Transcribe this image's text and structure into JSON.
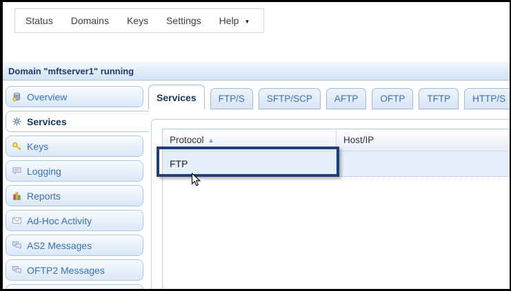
{
  "menu_bar": {
    "items": [
      "Status",
      "Domains",
      "Keys",
      "Settings",
      "Help"
    ]
  },
  "icons": {
    "caret_down": "▼",
    "sort_ascending": "▲"
  },
  "domain_header": {
    "title": "Domain \"mftserver1\" running"
  },
  "sidebar": {
    "items": [
      {
        "label": "Overview",
        "icon": "database-icon",
        "active": false
      },
      {
        "label": "Services",
        "icon": "services-icon",
        "active": true
      },
      {
        "label": "Keys",
        "icon": "key-icon",
        "active": false
      },
      {
        "label": "Logging",
        "icon": "speech-bubble-icon",
        "active": false
      },
      {
        "label": "Reports",
        "icon": "bar-chart-icon",
        "active": false
      },
      {
        "label": "Ad-Hoc Activity",
        "icon": "envelope-icon",
        "active": false
      },
      {
        "label": "AS2 Messages",
        "icon": "chat-bubbles-icon",
        "active": false
      },
      {
        "label": "OFTP2 Messages",
        "icon": "chat-bubbles-icon",
        "active": false
      }
    ]
  },
  "tabs": {
    "items": [
      {
        "label": "Services",
        "active": true
      },
      {
        "label": "FTP/S",
        "active": false
      },
      {
        "label": "SFTP/SCP",
        "active": false
      },
      {
        "label": "AFTP",
        "active": false
      },
      {
        "label": "OFTP",
        "active": false
      },
      {
        "label": "TFTP",
        "active": false
      },
      {
        "label": "HTTP/S",
        "active": false
      }
    ]
  },
  "services_table": {
    "columns": [
      {
        "label": "Protocol",
        "sorted": "ascending"
      },
      {
        "label": "Host/IP",
        "sorted": null
      }
    ],
    "rows": [
      {
        "protocol": "FTP",
        "host_ip": "",
        "selected": true,
        "highlighted": true
      }
    ]
  },
  "colors": {
    "domain_header_text": "#1c3a6e",
    "sidebar_link_text": "#3a6fb0",
    "active_tab_text": "#16365c",
    "selected_row_bg": "#e5effa",
    "highlight_box_border": "#1e3f78",
    "tab_border": "#9db9dc"
  },
  "cursor": {
    "type": "arrow"
  }
}
